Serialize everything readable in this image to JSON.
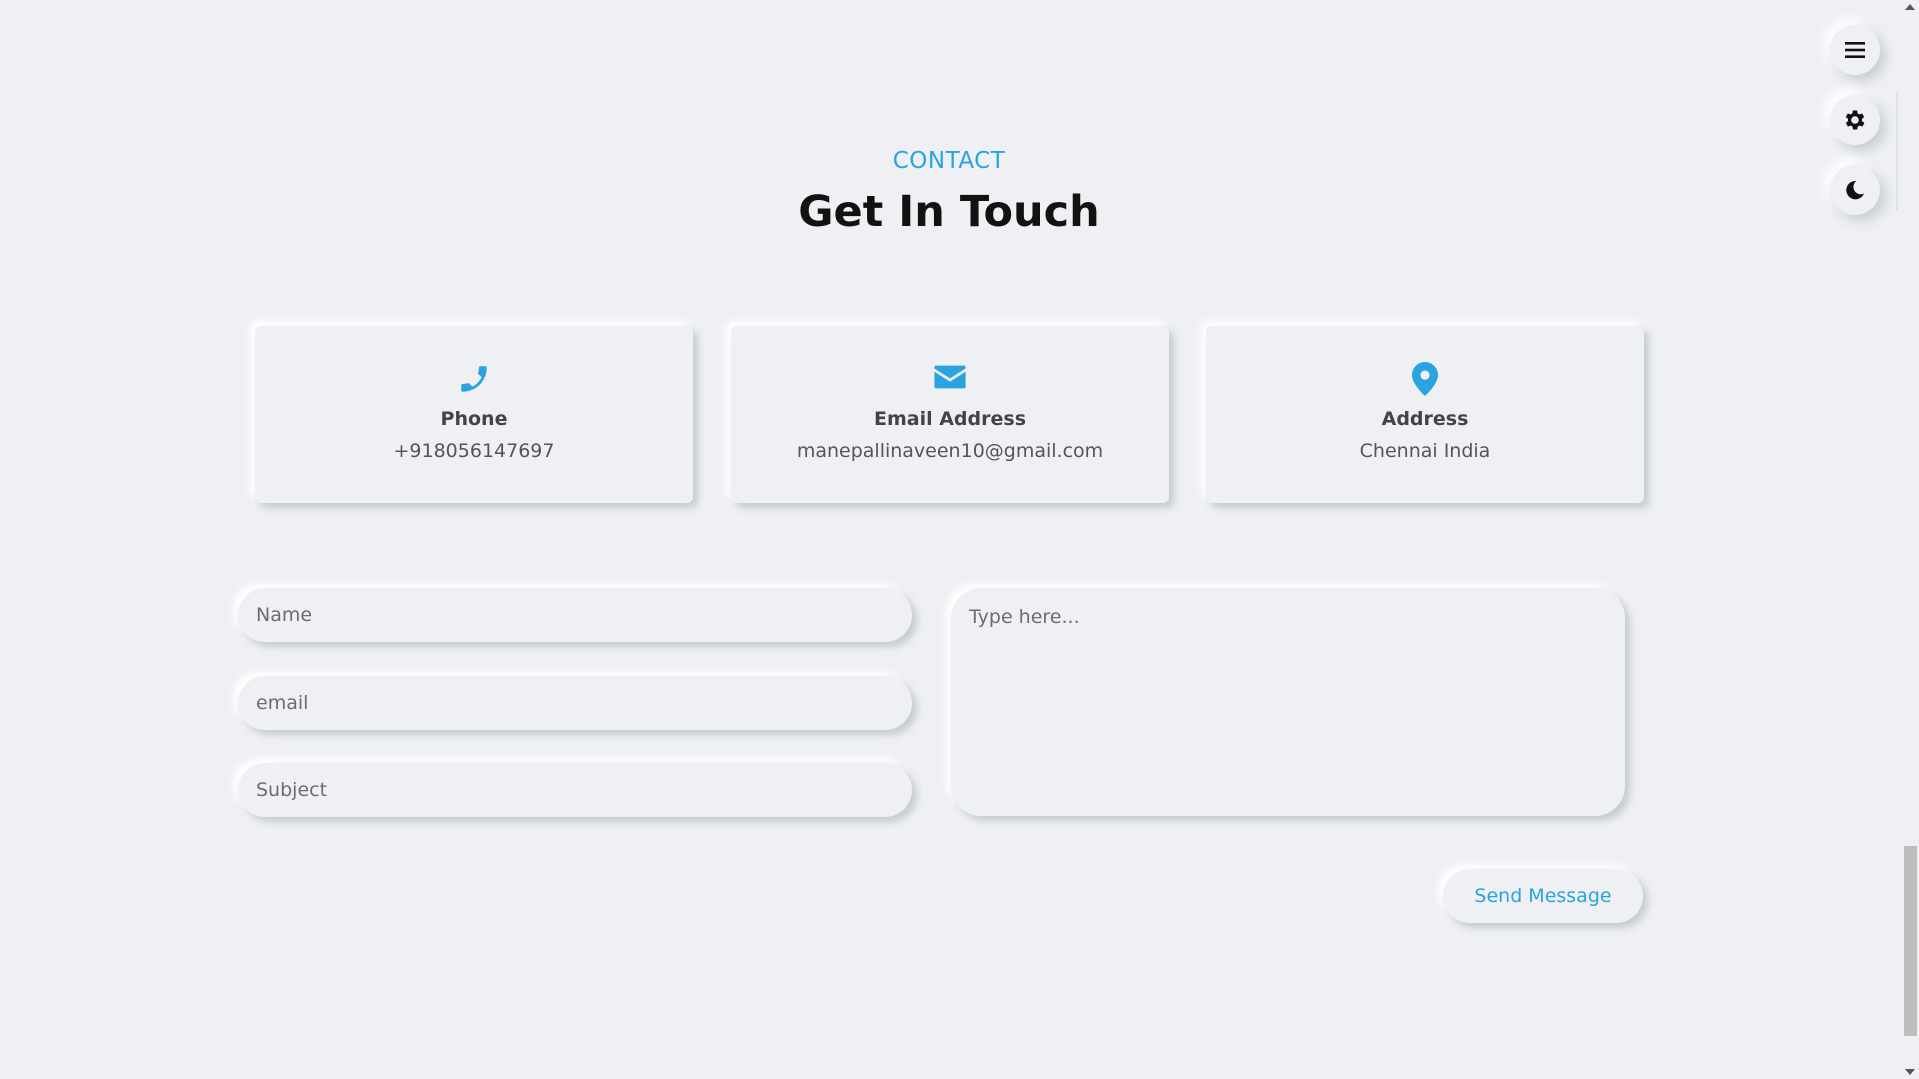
{
  "section": {
    "kicker": "CONTACT",
    "title": "Get In Touch"
  },
  "cards": [
    {
      "icon": "phone-icon",
      "label": "Phone",
      "value": "+918056147697"
    },
    {
      "icon": "envelope-icon",
      "label": "Email Address",
      "value": "manepallinaveen10@gmail.com"
    },
    {
      "icon": "map-pin-icon",
      "label": "Address",
      "value": "Chennai India"
    }
  ],
  "form": {
    "name_placeholder": "Name",
    "email_placeholder": "email",
    "subject_placeholder": "Subject",
    "message_placeholder": "Type here...",
    "submit_label": "Send Message"
  },
  "floating_buttons": [
    "menu-icon",
    "gear-icon",
    "moon-icon"
  ],
  "colors": {
    "accent": "#2ba3df",
    "background": "#eef0f4",
    "heading": "#121212"
  }
}
